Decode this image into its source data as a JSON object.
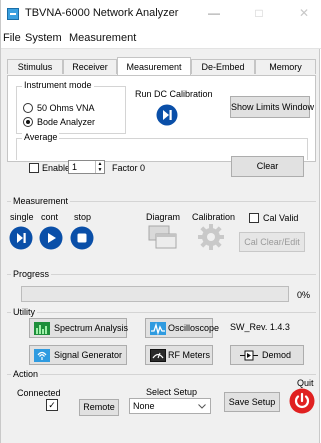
{
  "window": {
    "title": "TBVNA-6000 Network Analyzer",
    "minimize": "—",
    "maximize": "□",
    "close": "✕"
  },
  "menu": {
    "items": [
      "File",
      "System",
      "Measurement"
    ]
  },
  "tabs": [
    "Stimulus",
    "Receiver",
    "Measurement",
    "De-Embed",
    "Memory"
  ],
  "active_tab": "Measurement",
  "instrument_mode": {
    "title": "Instrument mode",
    "options": [
      "50 Ohms VNA",
      "Bode Analyzer"
    ],
    "selected": "Bode Analyzer"
  },
  "run_dc_calibration": {
    "label": "Run DC Calibration"
  },
  "show_limits_window": {
    "label": "Show Limits Window"
  },
  "average": {
    "title": "Average",
    "enable_label": "Enable",
    "enabled": false,
    "value": "1",
    "factor_label": "Factor 0",
    "clear_label": "Clear"
  },
  "measurement": {
    "title": "Measurement",
    "single": "single",
    "cont": "cont",
    "stop": "stop",
    "diagram": "Diagram",
    "calibration": "Calibration",
    "cal_valid": "Cal Valid",
    "cal_clear_edit": "Cal Clear/Edit"
  },
  "progress": {
    "title": "Progress",
    "percent_text": "0%",
    "value": 0
  },
  "utility": {
    "title": "Utility",
    "spectrum_analysis": "Spectrum Analysis",
    "oscilloscope": "Oscilloscope",
    "sw_rev": "SW_Rev. 1.4.3",
    "signal_generator": "Signal Generator",
    "rf_meters": "RF Meters",
    "demod": "Demod"
  },
  "action": {
    "title": "Action",
    "connected_label": "Connected",
    "connected": true,
    "remote_label": "Remote",
    "select_setup_label": "Select Setup",
    "select_setup_value": "None",
    "save_setup_label": "Save Setup",
    "quit_label": "Quit"
  },
  "colors": {
    "accent_blue": "#0a4fa8",
    "quit_red": "#e02020",
    "util_icon_blue": "#2f9be0",
    "spectrum_green": "#1d8f3a"
  }
}
